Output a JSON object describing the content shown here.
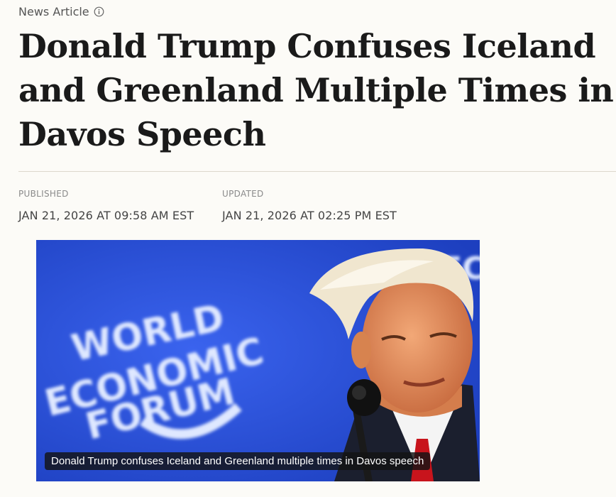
{
  "article": {
    "kicker": "News Article",
    "headline": "Donald Trump Confuses Iceland and Greenland Multiple Times in Davos Speech",
    "published_label": "PUBLISHED",
    "published_value": "JAN 21, 2026 AT 09:58 AM EST",
    "updated_label": "UPDATED",
    "updated_value": "JAN 21, 2026 AT 02:25 PM EST"
  },
  "media": {
    "backdrop_logo_lines": [
      "WORLD",
      "ECONOMIC",
      "FORUM"
    ],
    "caption": "Donald Trump confuses Iceland and Greenland multiple times in Davos speech"
  },
  "icons": {
    "kicker_icon": "info-circle-icon"
  },
  "colors": {
    "background": "#fcfbf7",
    "stage_blue": "#2a4fd6",
    "caption_bg": "#141414"
  }
}
